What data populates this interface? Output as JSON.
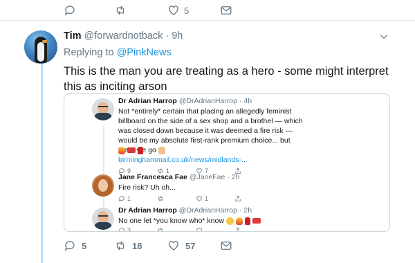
{
  "top_actions": {
    "reply_count": "",
    "retweet_count": "",
    "like_count": "5"
  },
  "tweet": {
    "author_name": "Tim",
    "author_handle": "@forwardnotback",
    "time": "· 9h",
    "replying_prefix": "Replying to",
    "replying_to": "@PinkNews",
    "text": "This is the man you are treating as a hero - some might interpret this as inciting arson",
    "actions": {
      "reply_count": "5",
      "retweet_count": "18",
      "like_count": "57"
    }
  },
  "embedded": {
    "tweets": [
      {
        "name": "Dr Adrian Harrop",
        "handle": "@DrAdrianHarrop",
        "time": "· 4h",
        "text": "Not *entirely* certain that placing an allegedly feminist billboard on the side of a sex shop and a brothel — which was closed down because it was deemed a fire risk — would be my absolute first-rank premium choice... but there we go",
        "link": "birminghammail.co.uk/news/midlands-...",
        "reply_count": "9",
        "retweet_count": "1",
        "like_count": "7"
      },
      {
        "name": "Jane Francesca Fae",
        "handle": "@JaneFae",
        "time": "· 2h",
        "text": "Fire risk? Uh oh...",
        "reply_count": "1",
        "retweet_count": "",
        "like_count": "1"
      },
      {
        "name": "Dr Adrian Harrop",
        "handle": "@DrAdrianHarrop",
        "time": "· 2h",
        "text": "No one let *you know who* know",
        "reply_count": "3",
        "retweet_count": "",
        "like_count": ""
      }
    ]
  },
  "icons": [
    "reply-icon",
    "retweet-icon",
    "like-icon",
    "dm-icon",
    "chevron-down-icon",
    "share-icon"
  ],
  "colors": {
    "link": "#1b95e0",
    "muted": "#657786",
    "thread": "#b8dcf5"
  }
}
